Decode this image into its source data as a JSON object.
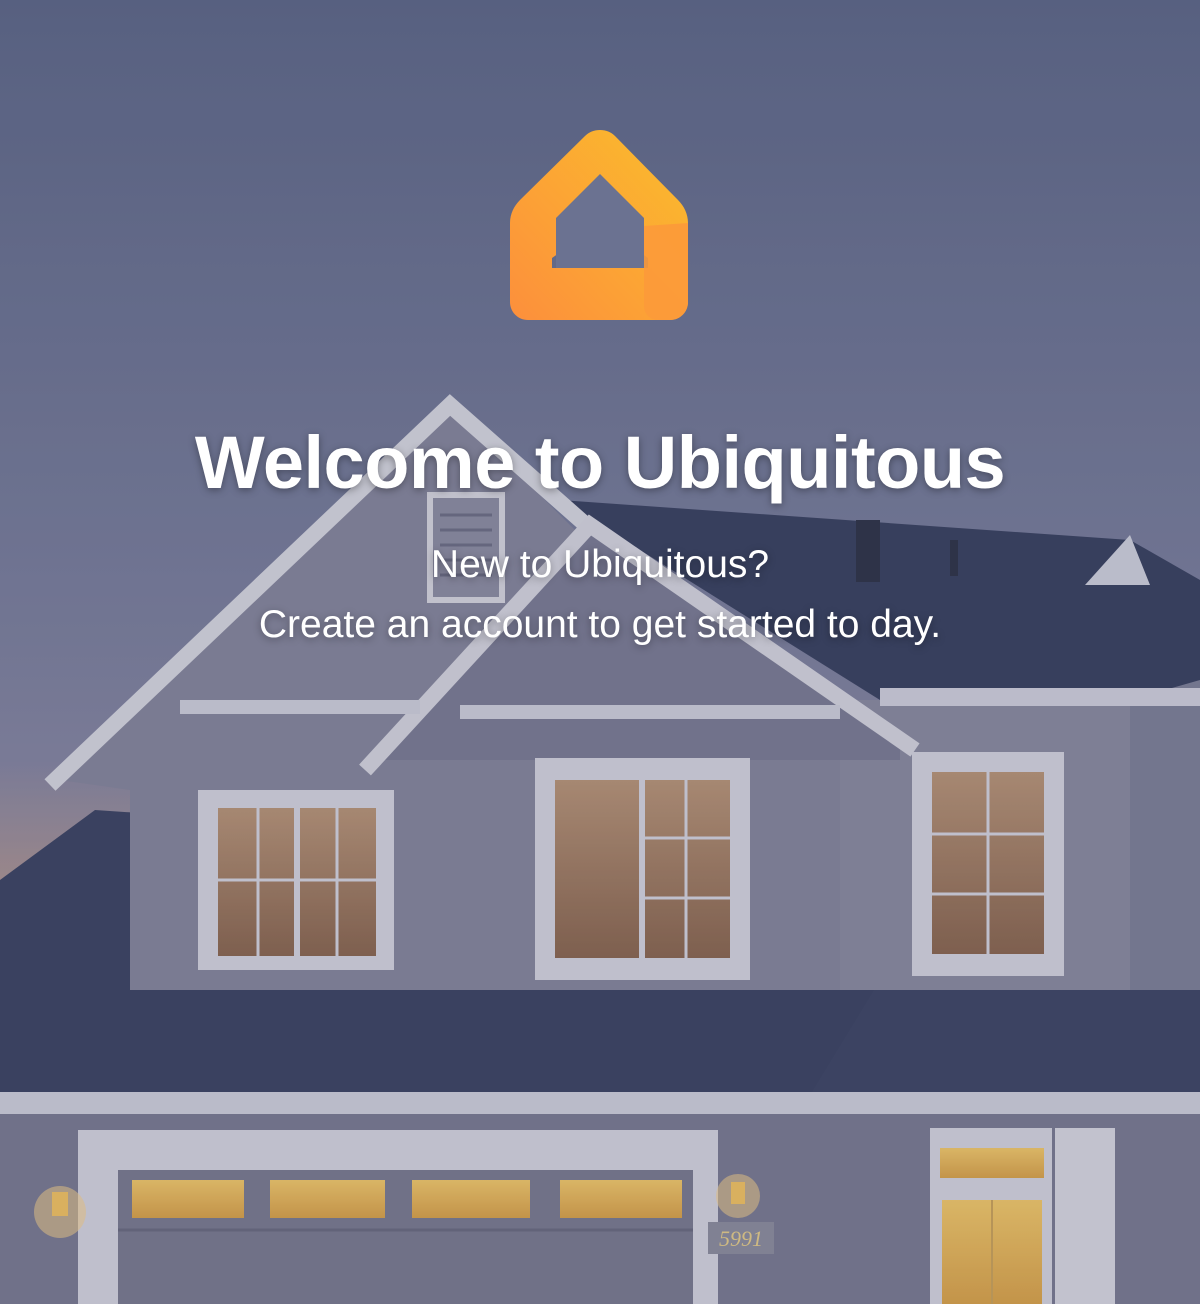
{
  "app": {
    "logo_icon": "home-icon",
    "accent_color": "#fbb033",
    "accent_color_dark": "#fc8f3c"
  },
  "welcome": {
    "title": "Welcome to Ubiquitous",
    "tagline_line1": "New to Ubiquitous?",
    "tagline_line2": "Create an account to get started to day."
  },
  "background": {
    "image": "house-photo",
    "house_number": "5991"
  }
}
